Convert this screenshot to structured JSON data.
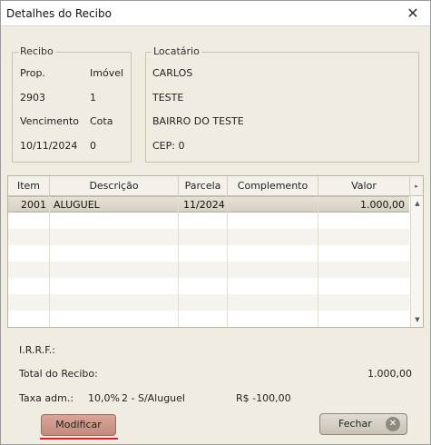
{
  "window": {
    "title": "Detalhes do Recibo",
    "close_glyph": "✕"
  },
  "recibo": {
    "legend": "Recibo",
    "prop_label": "Prop.",
    "imovel_label": "Imóvel",
    "prop_value": "2903",
    "imovel_value": "1",
    "vencimento_label": "Vencimento",
    "cota_label": "Cota",
    "vencimento_value": "10/11/2024",
    "cota_value": "0"
  },
  "locatario": {
    "legend": "Locatário",
    "name": "CARLOS",
    "address": "TESTE",
    "district": "BAIRRO DO TESTE",
    "cep": "CEP:  0"
  },
  "grid": {
    "columns": [
      "Item",
      "Descrição",
      "Parcela",
      "Complemento",
      "Valor"
    ],
    "rows": [
      {
        "item": "2001",
        "descricao": "ALUGUEL",
        "parcela": "11/2024",
        "complemento": "",
        "valor": "1.000,00"
      }
    ],
    "scroll_right_glyph": "▸",
    "scroll_up_glyph": "▲",
    "scroll_down_glyph": "▼"
  },
  "summary": {
    "irrf_label": "I.R.R.F.:",
    "total_label": "Total do Recibo:",
    "total_value": "1.000,00",
    "taxa_label": "Taxa adm.:",
    "taxa_percent": "10,0%",
    "taxa_desc": "2 - S/Aluguel",
    "taxa_value": "R$ -100,00"
  },
  "buttons": {
    "modificar": "Modificar",
    "fechar": "Fechar",
    "fechar_icon_glyph": "✕"
  }
}
